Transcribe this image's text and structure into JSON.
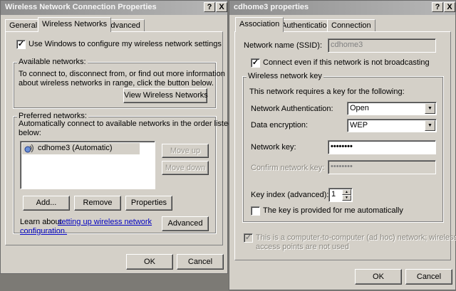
{
  "left_dialog": {
    "title": "Wireless Network Connection Properties",
    "help_btn": "?",
    "close_btn": "X",
    "tabs": [
      "General",
      "Wireless Networks",
      "Advanced"
    ],
    "use_windows_label": "Use Windows to configure my wireless network settings",
    "use_windows_checked": true,
    "available": {
      "legend": "Available networks:",
      "line1": "To connect to, disconnect from, or find out more information",
      "line2": "about wireless networks in range, click the button below.",
      "view_button": "View Wireless Networks"
    },
    "preferred": {
      "legend": "Preferred networks:",
      "line1": "Automatically connect to available networks in the order listed",
      "line2": "below:",
      "networks": [
        "cdhome3 (Automatic)"
      ],
      "move_up": "Move up",
      "move_down": "Move down",
      "add": "Add...",
      "remove": "Remove",
      "properties": "Properties"
    },
    "learn_prefix": "Learn about",
    "learn_link1": "setting up wireless network",
    "learn_link2": "configuration.",
    "advanced_button": "Advanced",
    "ok": "OK",
    "cancel": "Cancel"
  },
  "right_dialog": {
    "title": "cdhome3 properties",
    "help_btn": "?",
    "close_btn": "X",
    "tabs": [
      "Association",
      "Authentication",
      "Connection"
    ],
    "ssid_label": "Network name (SSID):",
    "ssid_value": "cdhome3",
    "broadcast_label": "Connect even if this network is not broadcasting",
    "broadcast_checked": true,
    "key_group": {
      "legend": "Wireless network key",
      "intro": "This network requires a key for the following:",
      "auth_label": "Network Authentication:",
      "auth_value": "Open",
      "enc_label": "Data encryption:",
      "enc_value": "WEP",
      "key_label": "Network key:",
      "key_value": "••••••••",
      "confirm_label": "Confirm network key:",
      "confirm_value": "••••••••",
      "index_label": "Key index (advanced):",
      "index_value": "1",
      "auto_key_label": "The key is provided for me automatically",
      "auto_key_checked": false
    },
    "adhoc_line1": "This is a computer-to-computer (ad hoc) network; wireless",
    "adhoc_line2": "access points are not used",
    "adhoc_checked": true,
    "ok": "OK",
    "cancel": "Cancel"
  },
  "icons": {
    "check": "✓",
    "dropdown": "▼",
    "spin_up": "▲",
    "spin_down": "▼",
    "network": "wireless-network-icon"
  }
}
